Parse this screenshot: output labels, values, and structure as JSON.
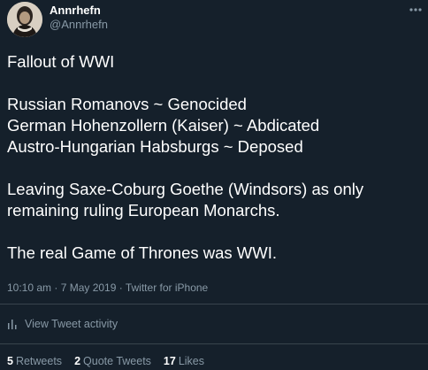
{
  "user": {
    "display_name": "Annrhefn",
    "handle": "@Annrhefn",
    "avatar_icon": "profile-photo"
  },
  "tweet": {
    "lines": [
      "Fallout of WWI",
      "",
      "Russian Romanovs ~ Genocided",
      "German Hohenzollern (Kaiser) ~ Abdicated",
      "Austro-Hungarian Habsburgs ~ Deposed",
      "",
      "Leaving Saxe-Coburg Goethe (Windsors) as only",
      "remaining ruling European Monarchs.",
      "",
      "The real Game of Thrones was WWI."
    ],
    "meta": "10:10 am · 7 May 2019 · Twitter for iPhone"
  },
  "activity": {
    "label": "View Tweet activity",
    "icon": "bar-chart-icon"
  },
  "stats": {
    "retweets_count": "5",
    "retweets_label": "Retweets",
    "quotes_count": "2",
    "quotes_label": "Quote Tweets",
    "likes_count": "17",
    "likes_label": "Likes"
  },
  "colors": {
    "background": "#15202b",
    "primary_text": "#ffffff",
    "secondary_text": "#8899a6",
    "divider": "#38444d"
  }
}
